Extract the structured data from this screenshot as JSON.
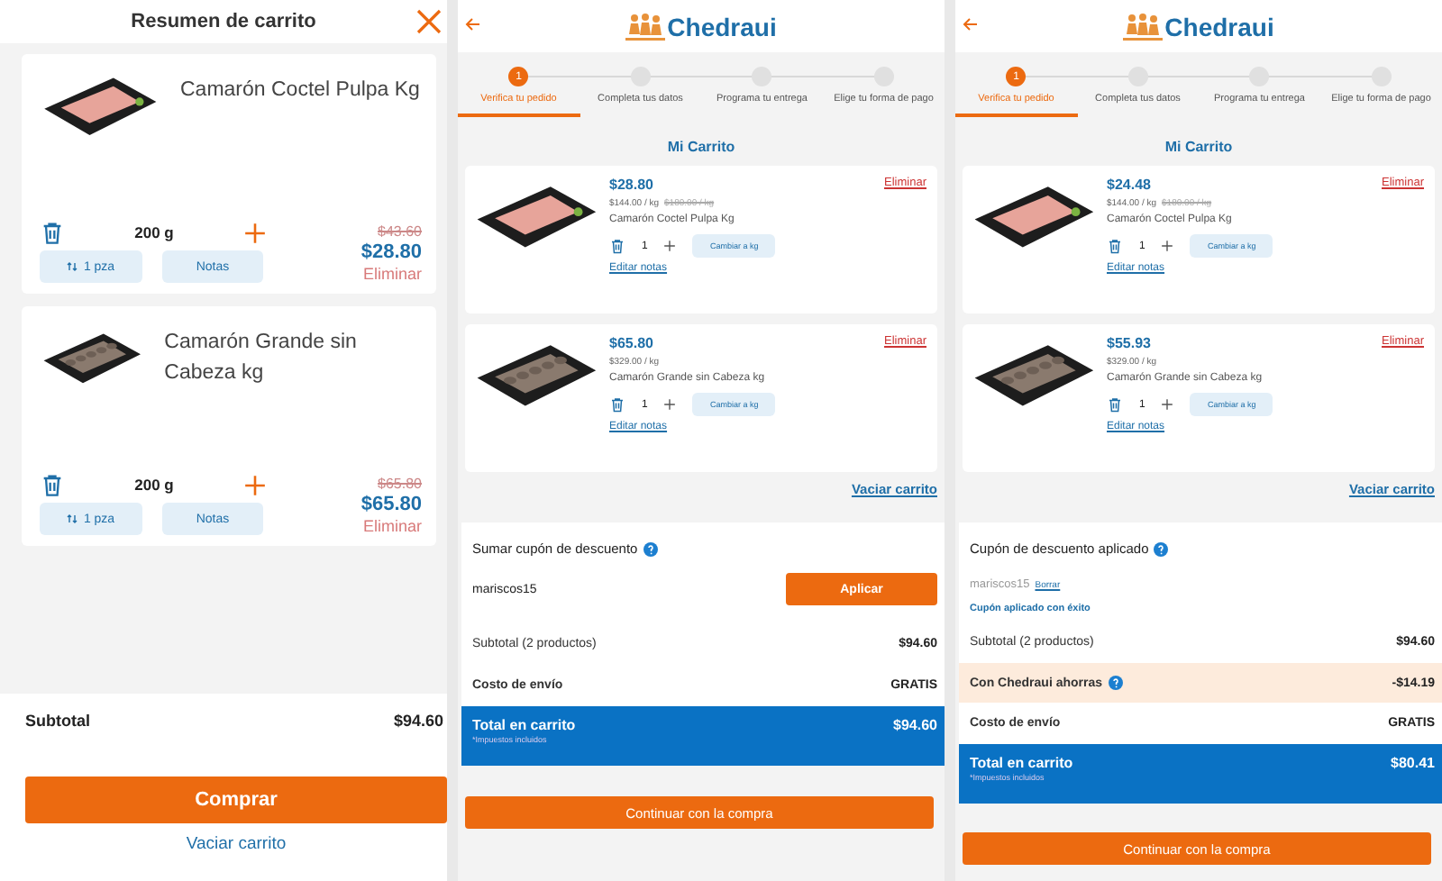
{
  "drawer": {
    "title": "Resumen de carrito",
    "items": [
      {
        "name": "Camarón Coctel Pulpa Kg",
        "kind": "pink",
        "qty": "200 g",
        "pieces": "1 pza",
        "notes": "Notas",
        "old_price": "$43.60",
        "price": "$28.80",
        "remove": "Eliminar"
      },
      {
        "name": "Camarón Grande sin Cabeza kg",
        "kind": "grey",
        "qty": "200 g",
        "pieces": "1 pza",
        "notes": "Notas",
        "old_price": "$65.80",
        "price": "$65.80",
        "remove": "Eliminar"
      }
    ],
    "subtotal_label": "Subtotal",
    "subtotal": "$94.60",
    "buy": "Comprar",
    "empty": "Vaciar carrito"
  },
  "screens": [
    {
      "logo": "Chedraui",
      "steps": [
        {
          "number": "1",
          "label": "Verifica tu pedido",
          "selected": true
        },
        {
          "label": "Completa tus datos",
          "selected": false
        },
        {
          "label": "Programa tu entrega",
          "selected": false
        },
        {
          "label": "Elige tu forma de pago",
          "selected": false
        }
      ],
      "heading": "Mi Carrito",
      "items": [
        {
          "kind": "pink",
          "price": "$28.80",
          "unit_price": "$144.00 / kg",
          "old_unit_price": "$180.00 / kg",
          "name": "Camarón Coctel Pulpa Kg",
          "qty": "1",
          "change_unit": "Cambiar a kg",
          "edit_notes": "Editar notas",
          "remove": "Eliminar"
        },
        {
          "kind": "grey",
          "price": "$65.80",
          "unit_price": "$329.00 / kg",
          "name": "Camarón Grande sin Cabeza kg",
          "qty": "1",
          "change_unit": "Cambiar a kg",
          "edit_notes": "Editar notas",
          "remove": "Eliminar"
        }
      ],
      "empty": "Vaciar carrito",
      "coupon": {
        "kind": "entry",
        "title": "Sumar cupón de descuento",
        "value": "mariscos15",
        "action": "Aplicar"
      },
      "rows": [
        {
          "kind": "plain",
          "label": "Subtotal (2 productos)",
          "value": "$94.60"
        },
        {
          "kind": "bold",
          "label": "Costo de envío",
          "value": "GRATIS"
        }
      ],
      "total": {
        "label": "Total en carrito",
        "note": "*Impuestos incluidos",
        "value": "$94.60"
      },
      "continue": "Continuar con la compra"
    },
    {
      "logo": "Chedraui",
      "steps": [
        {
          "number": "1",
          "label": "Verifica tu pedido",
          "selected": true
        },
        {
          "label": "Completa tus datos",
          "selected": false
        },
        {
          "label": "Programa tu entrega",
          "selected": false
        },
        {
          "label": "Elige tu forma de pago",
          "selected": false
        }
      ],
      "heading": "Mi Carrito",
      "items": [
        {
          "kind": "pink",
          "price": "$24.48",
          "unit_price": "$144.00 / kg",
          "old_unit_price": "$180.00 / kg",
          "name": "Camarón Coctel Pulpa Kg",
          "qty": "1",
          "change_unit": "Cambiar a kg",
          "edit_notes": "Editar notas",
          "remove": "Eliminar"
        },
        {
          "kind": "grey",
          "price": "$55.93",
          "unit_price": "$329.00 / kg",
          "name": "Camarón Grande sin Cabeza kg",
          "qty": "1",
          "change_unit": "Cambiar a kg",
          "edit_notes": "Editar notas",
          "remove": "Eliminar"
        }
      ],
      "empty": "Vaciar carrito",
      "coupon": {
        "kind": "applied",
        "title": "Cupón de descuento aplicado",
        "value": "mariscos15",
        "action": "Borrar",
        "message": "Cupón aplicado con éxito"
      },
      "rows": [
        {
          "kind": "plain",
          "label": "Subtotal (2 productos)",
          "value": "$94.60"
        },
        {
          "kind": "savings",
          "label": "Con Chedraui ahorras",
          "value": "-$14.19"
        },
        {
          "kind": "bold",
          "label": "Costo de envío",
          "value": "GRATIS"
        }
      ],
      "total": {
        "label": "Total en carrito",
        "note": "*Impuestos incluidos",
        "value": "$80.41"
      },
      "continue": "Continuar con la compra"
    }
  ]
}
